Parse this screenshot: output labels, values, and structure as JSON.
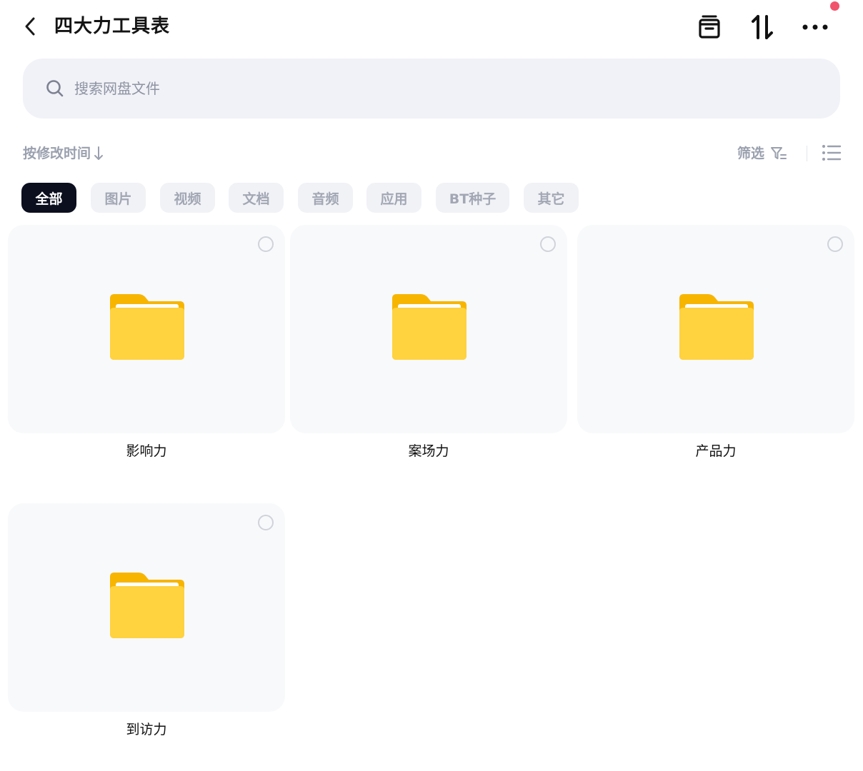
{
  "header": {
    "title": "四大力工具表",
    "icons": [
      "back-arrow-icon",
      "archive-box-icon",
      "sort-arrows-icon",
      "more-dots-icon"
    ],
    "notification_color": "#f2536c"
  },
  "search": {
    "placeholder": "搜索网盘文件"
  },
  "sort": {
    "label": "按修改时间",
    "filter_label": "筛选"
  },
  "chips": [
    {
      "label": "全部",
      "active": true
    },
    {
      "label": "图片",
      "active": false
    },
    {
      "label": "视频",
      "active": false
    },
    {
      "label": "文档",
      "active": false
    },
    {
      "label": "音频",
      "active": false
    },
    {
      "label": "应用",
      "active": false
    },
    {
      "label": "BT种子",
      "active": false
    },
    {
      "label": "其它",
      "active": false
    }
  ],
  "folders": [
    {
      "name": "影响力"
    },
    {
      "name": "案场力"
    },
    {
      "name": "产品力"
    },
    {
      "name": "到访力"
    }
  ],
  "colors": {
    "accent_dark": "#0b0f1e",
    "folder_yellow": "#ffcc33",
    "muted_text": "#9aa0ae"
  }
}
